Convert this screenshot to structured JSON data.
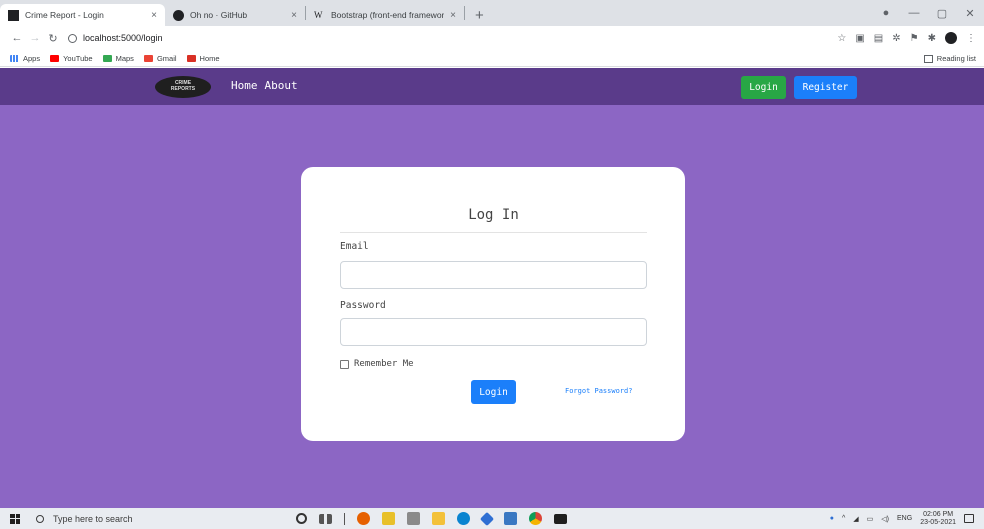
{
  "browser": {
    "tabs": [
      {
        "title": "Crime Report - Login",
        "active": true,
        "favicon_color": "#202124"
      },
      {
        "title": "Oh no · GitHub",
        "active": false,
        "favicon_color": "#202124"
      },
      {
        "title": "Bootstrap (front-end framework)",
        "active": false,
        "favicon_color": "#5f6368"
      }
    ],
    "new_tab": "+",
    "close_glyph": "×",
    "url": "localhost:5000/login",
    "bookmarks": [
      {
        "label": "Apps",
        "color": "#e8453c"
      },
      {
        "label": "YouTube",
        "color": "#ff0000"
      },
      {
        "label": "Maps",
        "color": "#34a853"
      },
      {
        "label": "Gmail",
        "color": "#ea4335"
      },
      {
        "label": "Home",
        "color": "#d93025"
      }
    ],
    "reading_list": "Reading list"
  },
  "navbar": {
    "brand": "CRIME REPORTS",
    "links": [
      "Home",
      "About"
    ],
    "login_label": "Login",
    "register_label": "Register",
    "bg_color": "#5a3b8a",
    "login_color": "#28a745",
    "register_color": "#1b7ffa"
  },
  "page": {
    "bg_color": "#8c66c4"
  },
  "login_form": {
    "title": "Log In",
    "email_label": "Email",
    "email_value": "",
    "password_label": "Password",
    "password_value": "",
    "remember_label": "Remember Me",
    "remember_checked": false,
    "submit_label": "Login",
    "forgot_label": "Forgot Password?"
  },
  "taskbar": {
    "search_placeholder": "Type here to search",
    "language": "ENG",
    "time": "02:06 PM",
    "date": "23-05-2021",
    "apps": [
      {
        "name": "cortana-icon",
        "color": ""
      },
      {
        "name": "task-view-icon",
        "color": "#555555"
      },
      {
        "name": "firefox-icon",
        "color": "#e66000"
      },
      {
        "name": "app-icon-yellow",
        "color": "#e8c02a"
      },
      {
        "name": "camera-icon",
        "color": "#8a8a8a"
      },
      {
        "name": "file-explorer-icon",
        "color": "#f3c13a"
      },
      {
        "name": "edge-icon",
        "color": "#0a84d0"
      },
      {
        "name": "app-icon-blue",
        "color": "#2f6fd3"
      },
      {
        "name": "store-icon",
        "color": "#3a78c2"
      },
      {
        "name": "chrome-icon",
        "color": "#db4437"
      },
      {
        "name": "terminal-icon",
        "color": "#1f1f1f"
      }
    ]
  }
}
